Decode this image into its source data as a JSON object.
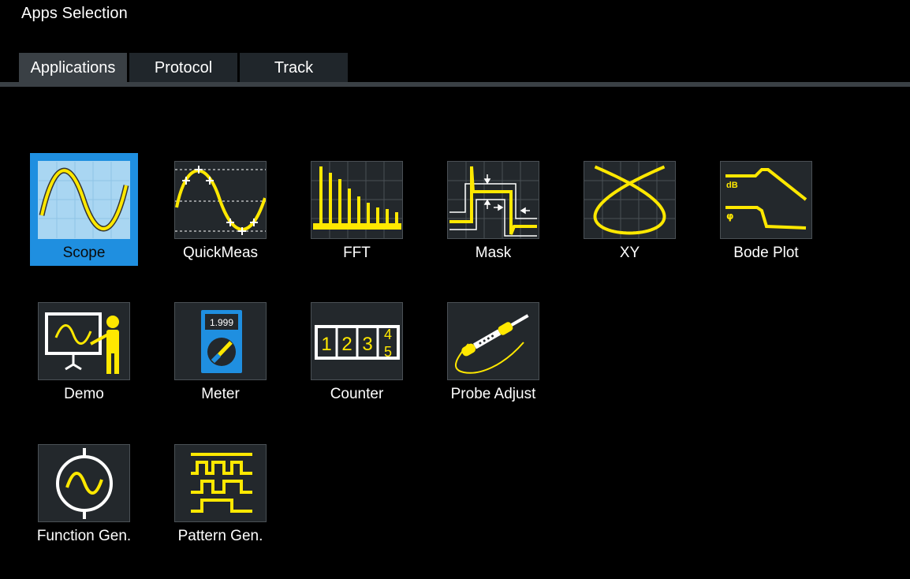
{
  "window": {
    "title": "Apps Selection"
  },
  "tabs": [
    {
      "label": "Applications",
      "active": true
    },
    {
      "label": "Protocol",
      "active": false
    },
    {
      "label": "Track",
      "active": false
    }
  ],
  "apps": [
    {
      "label": "Scope",
      "icon": "scope-icon",
      "selected": true
    },
    {
      "label": "QuickMeas",
      "icon": "quickmeas-icon"
    },
    {
      "label": "FFT",
      "icon": "fft-icon"
    },
    {
      "label": "Mask",
      "icon": "mask-icon"
    },
    {
      "label": "XY",
      "icon": "xy-icon"
    },
    {
      "label": "Bode Plot",
      "icon": "bode-plot-icon"
    },
    {
      "label": "Demo",
      "icon": "demo-icon"
    },
    {
      "label": "Meter",
      "icon": "meter-icon",
      "display_value": "1.999"
    },
    {
      "label": "Counter",
      "icon": "counter-icon",
      "digits": [
        "1",
        "2",
        "3",
        "4",
        "5"
      ]
    },
    {
      "label": "Probe Adjust",
      "icon": "probe-adjust-icon"
    },
    {
      "label": "Function Gen.",
      "icon": "function-gen-icon"
    },
    {
      "label": "Pattern Gen.",
      "icon": "pattern-gen-icon"
    }
  ],
  "bode": {
    "gain_label": "dB",
    "phase_label": "φ"
  },
  "colors": {
    "accent_yellow": "#ffe800",
    "selection_blue": "#1f8fe0",
    "tile_bg": "#23282c"
  }
}
